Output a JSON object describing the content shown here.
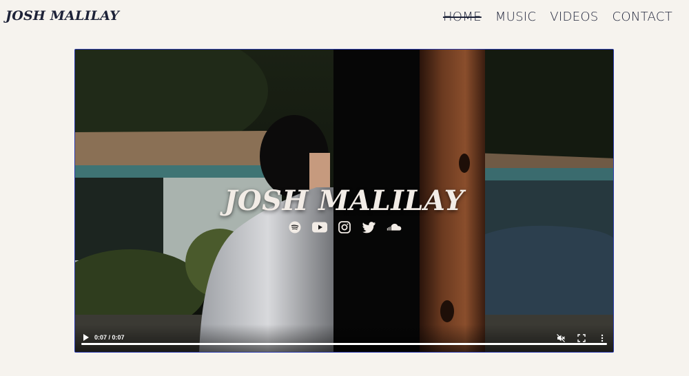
{
  "header": {
    "logo": "JOSH MALILAY",
    "nav": [
      {
        "label": "HOME",
        "active": true
      },
      {
        "label": "MUSIC",
        "active": false
      },
      {
        "label": "VIDEOS",
        "active": false
      },
      {
        "label": "CONTACT",
        "active": false
      }
    ]
  },
  "video": {
    "overlay_title": "JOSH MALILAY",
    "social_icons": [
      "spotify-icon",
      "youtube-icon",
      "instagram-icon",
      "twitter-icon",
      "soundcloud-icon"
    ],
    "time_display": "0:07 / 0:07",
    "progress": 1.0,
    "muted": true
  },
  "colors": {
    "background": "#f6f3ee",
    "text": "#1d2238",
    "video_border": "#2b3bb0"
  }
}
